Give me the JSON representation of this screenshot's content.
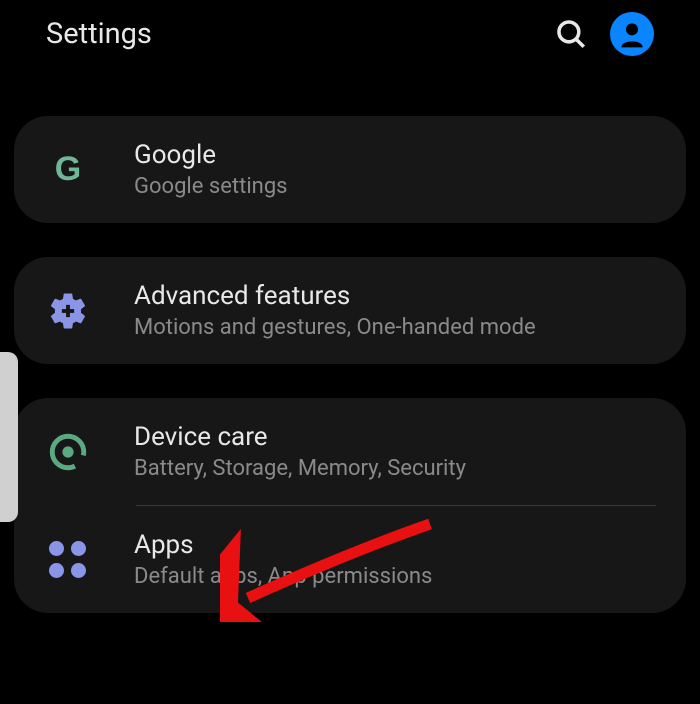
{
  "header": {
    "title": "Settings"
  },
  "items": {
    "google": {
      "title": "Google",
      "subtitle": "Google settings"
    },
    "advanced": {
      "title": "Advanced features",
      "subtitle": "Motions and gestures, One-handed mode"
    },
    "devicecare": {
      "title": "Device care",
      "subtitle": "Battery, Storage, Memory, Security"
    },
    "apps": {
      "title": "Apps",
      "subtitle": "Default apps, App permissions"
    }
  }
}
